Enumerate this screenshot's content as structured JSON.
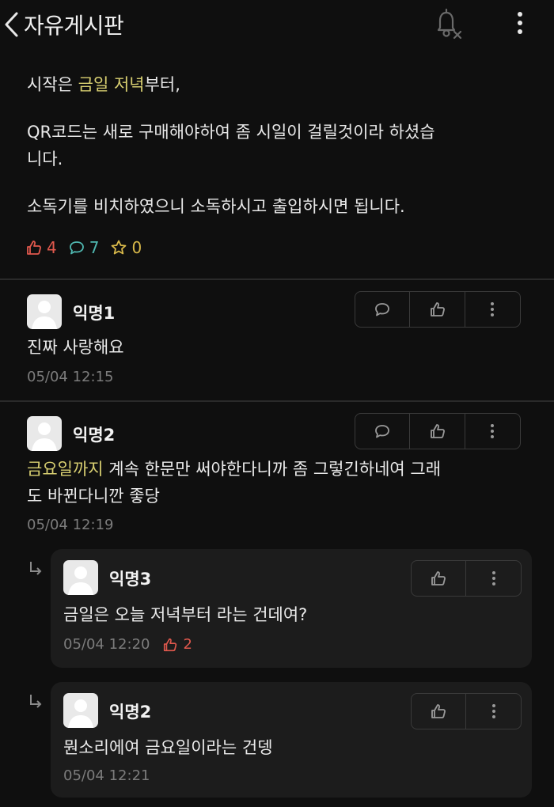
{
  "header": {
    "title": "자유게시판"
  },
  "post": {
    "line1_pre": "시작은 ",
    "line1_hl": "금일 저녁",
    "line1_post": "부터,",
    "line2a": "QR코드는 새로 구매해야하여 좀 시일이 걸릴것이라 하셨습",
    "line2b": "니다.",
    "line3": "소독기를 비치하였으니 소독하시고 출입하시면 됩니다.",
    "likes": "4",
    "comments": "7",
    "scraps": "0"
  },
  "comments": [
    {
      "name": "익명1",
      "text": "진짜 사랑해요",
      "time": "05/04 12:15"
    },
    {
      "name": "익명2",
      "text_hl": "금요일까지",
      "text_rest": " 계속 한문만 써야한다니까 좀 그렇긴하네여 그래",
      "text_line2": "도 바뀐다니깐 좋당",
      "time": "05/04 12:19"
    }
  ],
  "replies": [
    {
      "name": "익명3",
      "text": "금일은 오늘 저녁부터 라는 건데여?",
      "time": "05/04 12:20",
      "likes": "2"
    },
    {
      "name": "익명2",
      "text": "뭔소리에여 금요일이라는 건뎅",
      "time": "05/04 12:21"
    }
  ],
  "colors": {
    "background": "#0f0f0f",
    "highlight": "#d8cf71",
    "like": "#e0584d",
    "comment": "#4fb7b0",
    "scrap": "#d9b94a",
    "reply_bg": "#1c1c1c"
  },
  "icons": [
    "back-chevron-icon",
    "notification-off-icon",
    "more-vertical-icon",
    "thumbs-up-icon",
    "chat-bubble-icon",
    "star-icon",
    "reply-arrow-icon",
    "anonymous-avatar-icon"
  ]
}
